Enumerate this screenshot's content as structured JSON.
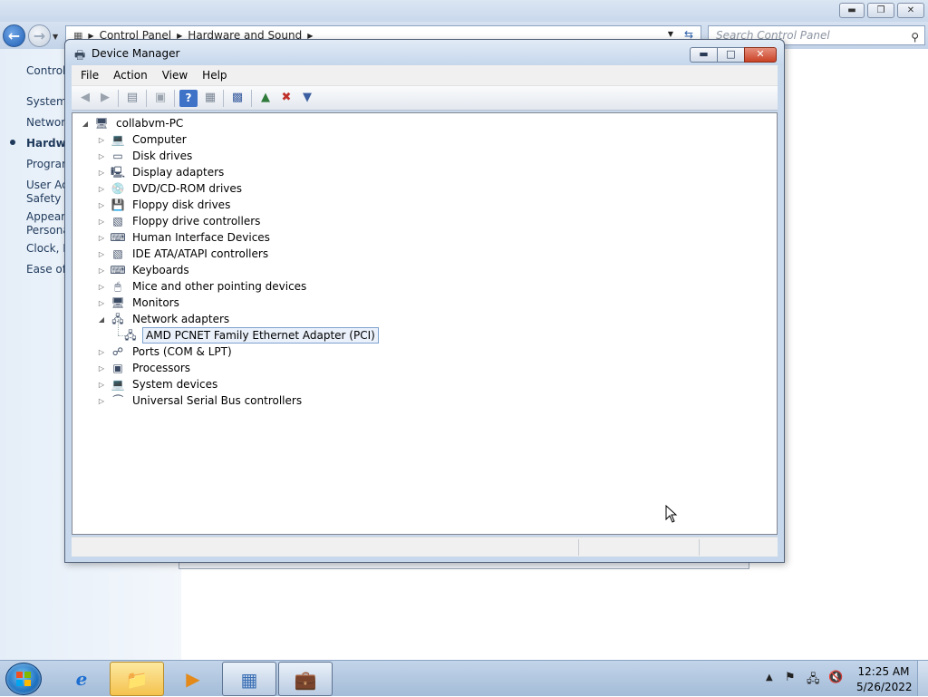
{
  "control_panel": {
    "address_crumbs": [
      "Control Panel",
      "Hardware and Sound"
    ],
    "search_placeholder": "Search Control Panel",
    "home_link": "Control",
    "sidebar_items": [
      "System",
      "Network",
      "Hardwa",
      "Program",
      "User Ac",
      "Safety",
      "Appeara",
      "Persona",
      "Clock, L",
      "Ease of A"
    ]
  },
  "device_manager": {
    "title": "Device Manager",
    "menu": [
      "File",
      "Action",
      "View",
      "Help"
    ],
    "toolbar_icons": [
      "back-icon",
      "forward-icon",
      "show-hide-console-tree-icon",
      "properties-icon",
      "help-icon",
      "action-pane-icon",
      "scan-hardware-icon",
      "update-driver-icon",
      "uninstall-icon",
      "disable-icon"
    ],
    "tree": {
      "root": "collabvm-PC",
      "categories": [
        {
          "label": "Computer",
          "icon": "computer-icon",
          "expanded": false
        },
        {
          "label": "Disk drives",
          "icon": "disk-drive-icon",
          "expanded": false
        },
        {
          "label": "Display adapters",
          "icon": "display-adapter-icon",
          "expanded": false
        },
        {
          "label": "DVD/CD-ROM drives",
          "icon": "dvd-drive-icon",
          "expanded": false
        },
        {
          "label": "Floppy disk drives",
          "icon": "floppy-disk-icon",
          "expanded": false
        },
        {
          "label": "Floppy drive controllers",
          "icon": "floppy-controller-icon",
          "expanded": false
        },
        {
          "label": "Human Interface Devices",
          "icon": "hid-icon",
          "expanded": false
        },
        {
          "label": "IDE ATA/ATAPI controllers",
          "icon": "ide-controller-icon",
          "expanded": false
        },
        {
          "label": "Keyboards",
          "icon": "keyboard-icon",
          "expanded": false
        },
        {
          "label": "Mice and other pointing devices",
          "icon": "mouse-icon",
          "expanded": false
        },
        {
          "label": "Monitors",
          "icon": "monitor-icon",
          "expanded": false
        },
        {
          "label": "Network adapters",
          "icon": "network-adapter-icon",
          "expanded": true
        },
        {
          "label": "Ports (COM & LPT)",
          "icon": "port-icon",
          "expanded": false
        },
        {
          "label": "Processors",
          "icon": "processor-icon",
          "expanded": false
        },
        {
          "label": "System devices",
          "icon": "system-device-icon",
          "expanded": false
        },
        {
          "label": "Universal Serial Bus controllers",
          "icon": "usb-icon",
          "expanded": false
        }
      ],
      "selected_child": "AMD PCNET Family Ethernet Adapter (PCI)"
    }
  },
  "taskbar": {
    "time": "12:25 AM",
    "date": "5/26/2022",
    "pinned": [
      "internet-explorer-icon",
      "windows-explorer-icon",
      "media-player-icon",
      "control-panel-icon",
      "device-manager-icon"
    ],
    "tray": [
      "flag-icon",
      "network-icon",
      "volume-muted-icon"
    ]
  }
}
